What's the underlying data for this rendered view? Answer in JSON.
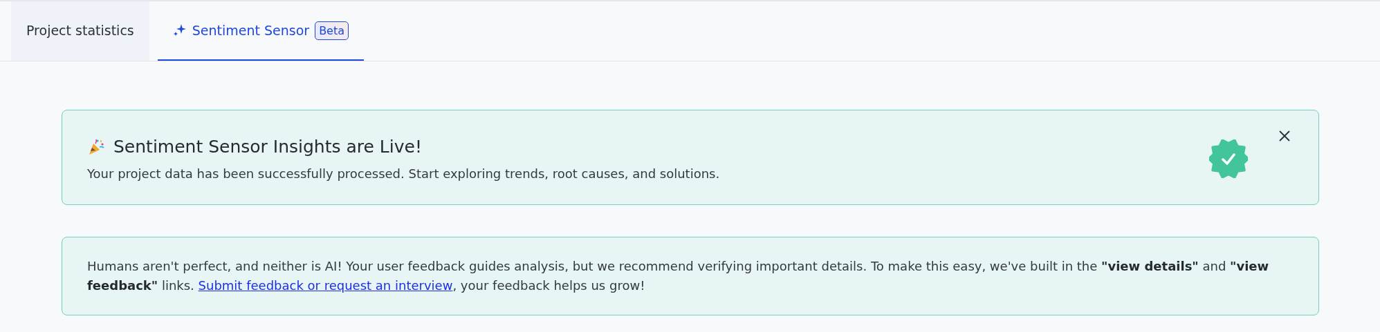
{
  "tabs": [
    {
      "label": "Project statistics",
      "selected": false,
      "kind": "plain"
    },
    {
      "label": "Sentiment Sensor",
      "selected": true,
      "kind": "ai",
      "badge": "Beta"
    }
  ],
  "banner": {
    "title": "Sentiment Sensor Insights are Live!",
    "message": "Your project data has been successfully processed. Start exploring trends, root causes, and solutions."
  },
  "notice": {
    "before": "Humans aren't perfect, and neither is AI! Your user feedback guides analysis, but we recommend verifying important details. To make this easy, we've built in the **\"view details\"** and **\"view feedback\"** links. ",
    "link": "Submit feedback or request an interview",
    "after": ", your feedback helps us grow!"
  }
}
